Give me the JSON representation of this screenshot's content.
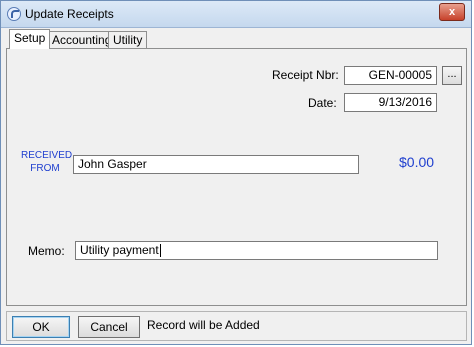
{
  "window": {
    "title": "Update Receipts",
    "close_label": "x"
  },
  "tabs": [
    {
      "label": "Setup",
      "active": true
    },
    {
      "label": "Accounting",
      "active": false
    },
    {
      "label": "Utility",
      "active": false
    }
  ],
  "form": {
    "receipt_nbr_label": "Receipt Nbr:",
    "receipt_nbr_value": "GEN-00005",
    "lookup_label": "...",
    "date_label": "Date:",
    "date_value": "9/13/2016",
    "received_from_label_line1": "RECEIVED",
    "received_from_label_line2": "FROM",
    "received_from_value": "John Gasper",
    "amount": "$0.00",
    "memo_label": "Memo:",
    "memo_value": "Utility payment"
  },
  "footer": {
    "ok_label": "OK",
    "cancel_label": "Cancel",
    "status": "Record will be Added"
  },
  "colors": {
    "accent_blue": "#1f3fcf",
    "title_bar": "#c5d8ee"
  },
  "icons": {
    "app": "app-refresh-icon",
    "close": "close-icon"
  }
}
